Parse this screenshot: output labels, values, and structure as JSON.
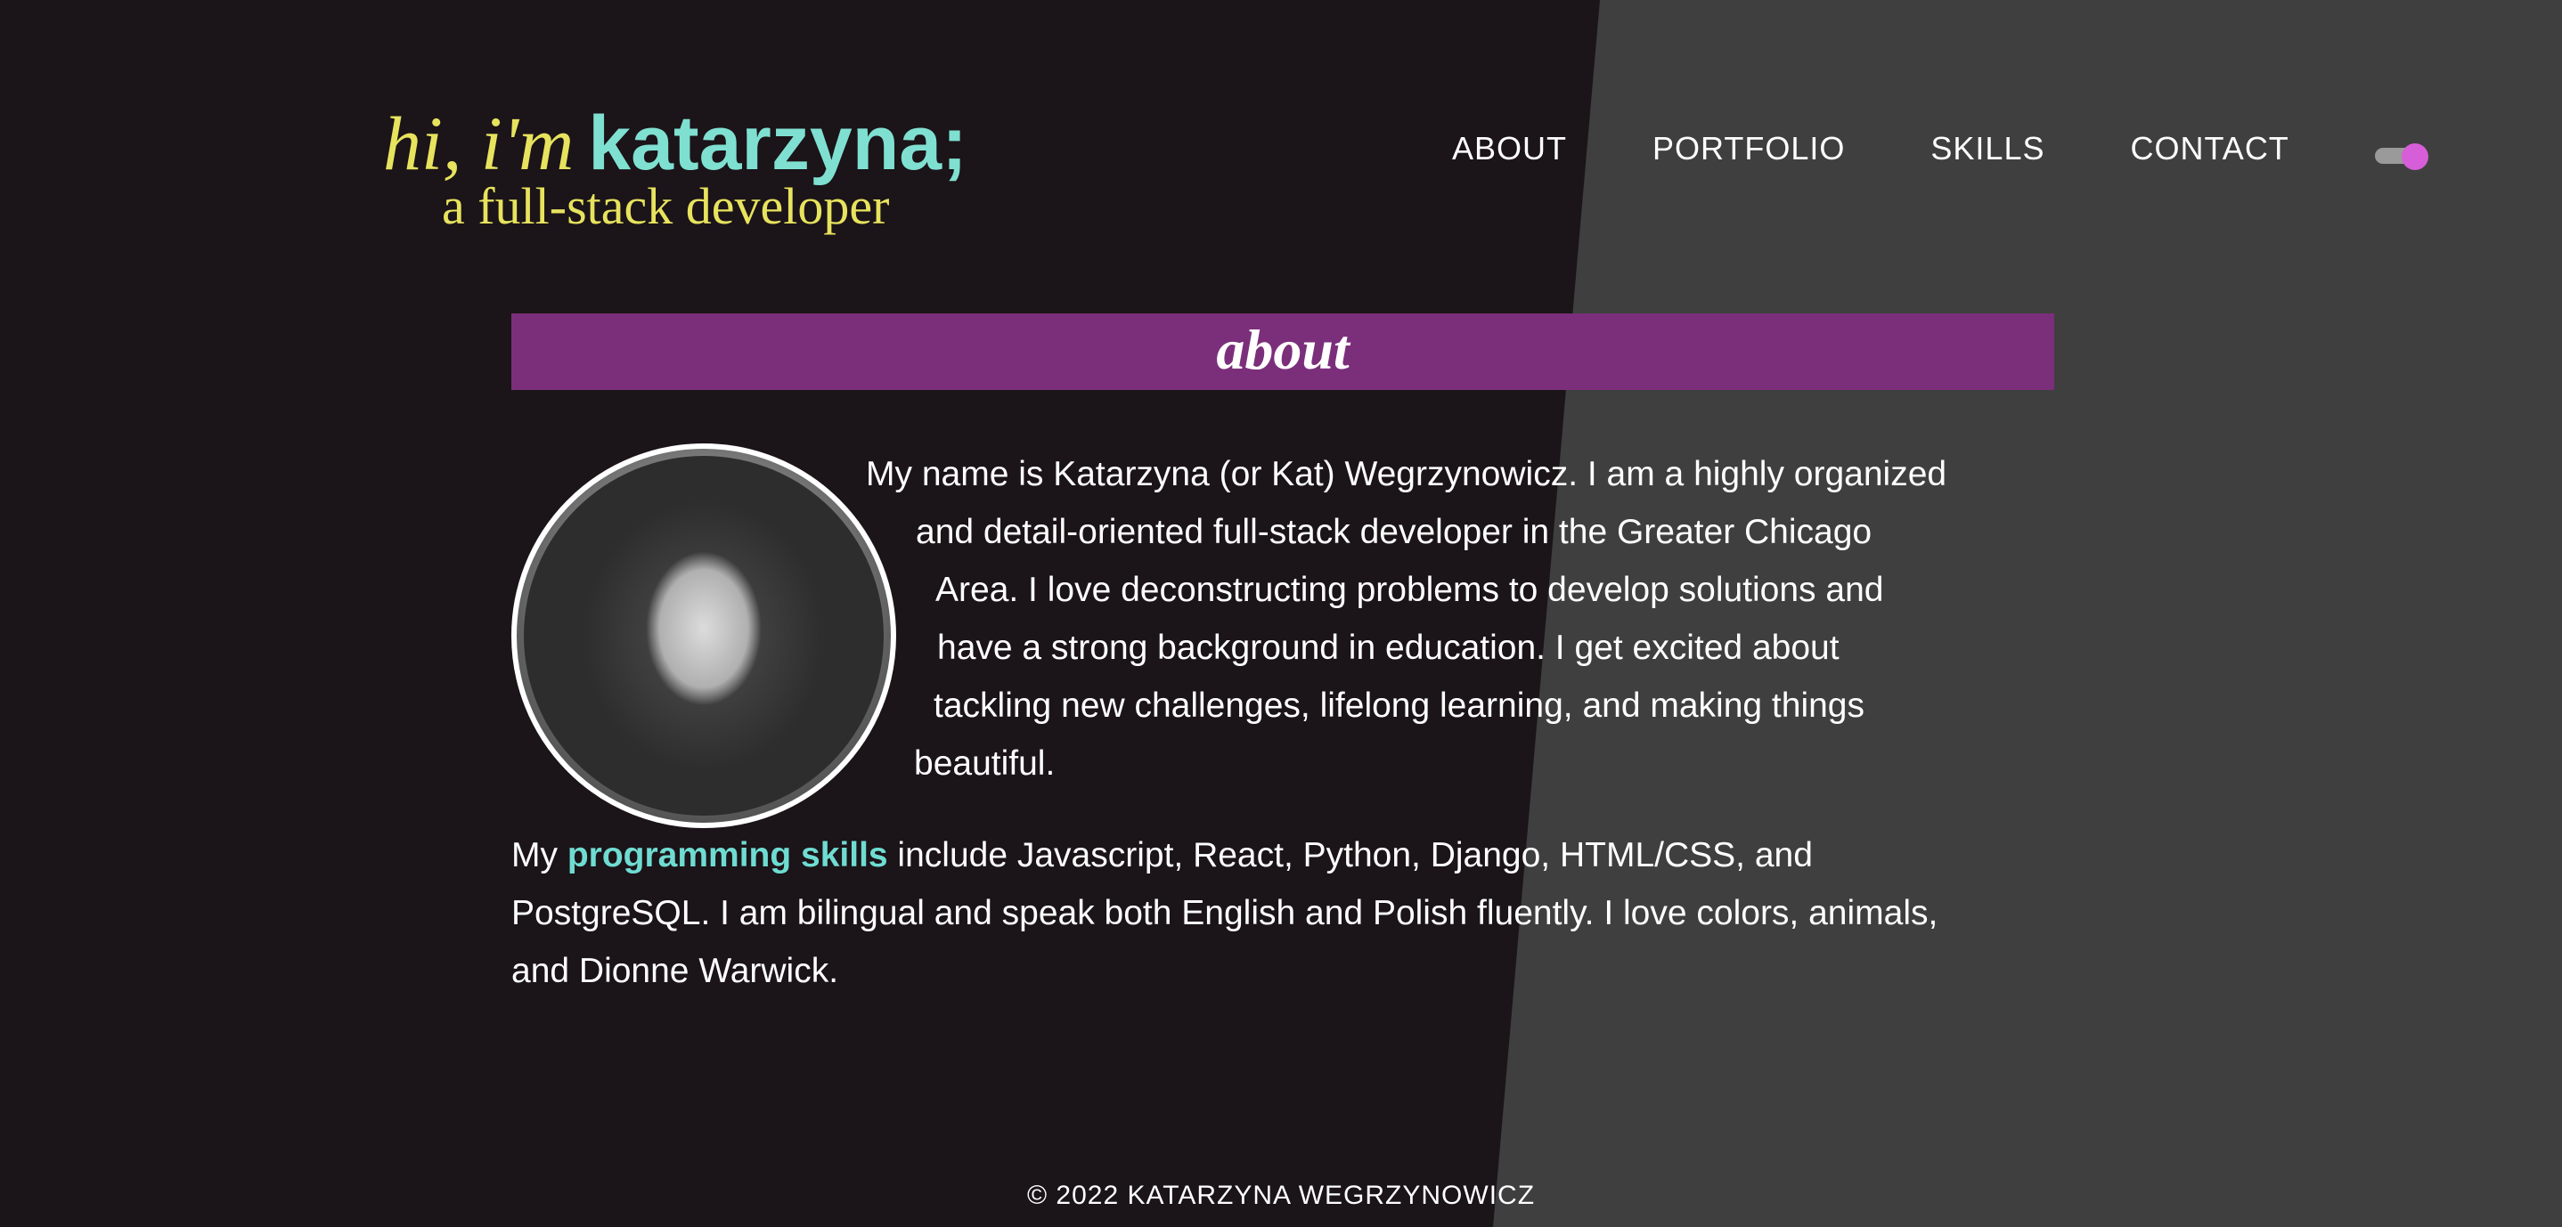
{
  "header": {
    "logo_hi": "hi, i'm",
    "logo_name": "katarzyna;",
    "logo_subtitle": "a full-stack developer"
  },
  "nav": {
    "items": [
      {
        "label": "ABOUT"
      },
      {
        "label": "PORTFOLIO"
      },
      {
        "label": "SKILLS"
      },
      {
        "label": "CONTACT"
      }
    ]
  },
  "theme_toggle": {
    "state": "on",
    "knob_color": "#d65ed8"
  },
  "about": {
    "title": "about",
    "bio_lines": [
      "My name is Katarzyna (or Kat) Wegrzynowicz. I am a highly organized",
      "and detail-oriented full-stack developer in the Greater Chicago",
      "Area. I love deconstructing problems to develop solutions and",
      "have a strong background in education. I get excited about",
      "tackling new challenges, lifelong learning, and making things",
      "beautiful."
    ],
    "skills_prefix": "My ",
    "skills_link": "programming skills",
    "skills_line1_rest": " include Javascript, React, Python, Django, HTML/CSS, and",
    "skills_line2": "PostgreSQL. I am bilingual and speak both English and Polish fluently. I love colors, animals,",
    "skills_line3": "and Dionne Warwick."
  },
  "footer": {
    "text": "© 2022 KATARZYNA WEGRZYNOWICZ"
  },
  "colors": {
    "background_dark": "#1b1418",
    "background_gray": "#3f3f3f",
    "accent_yellow": "#e7e35e",
    "accent_teal": "#7fe0d1",
    "about_bar": "#7b2f7b",
    "toggle_knob": "#d65ed8"
  }
}
